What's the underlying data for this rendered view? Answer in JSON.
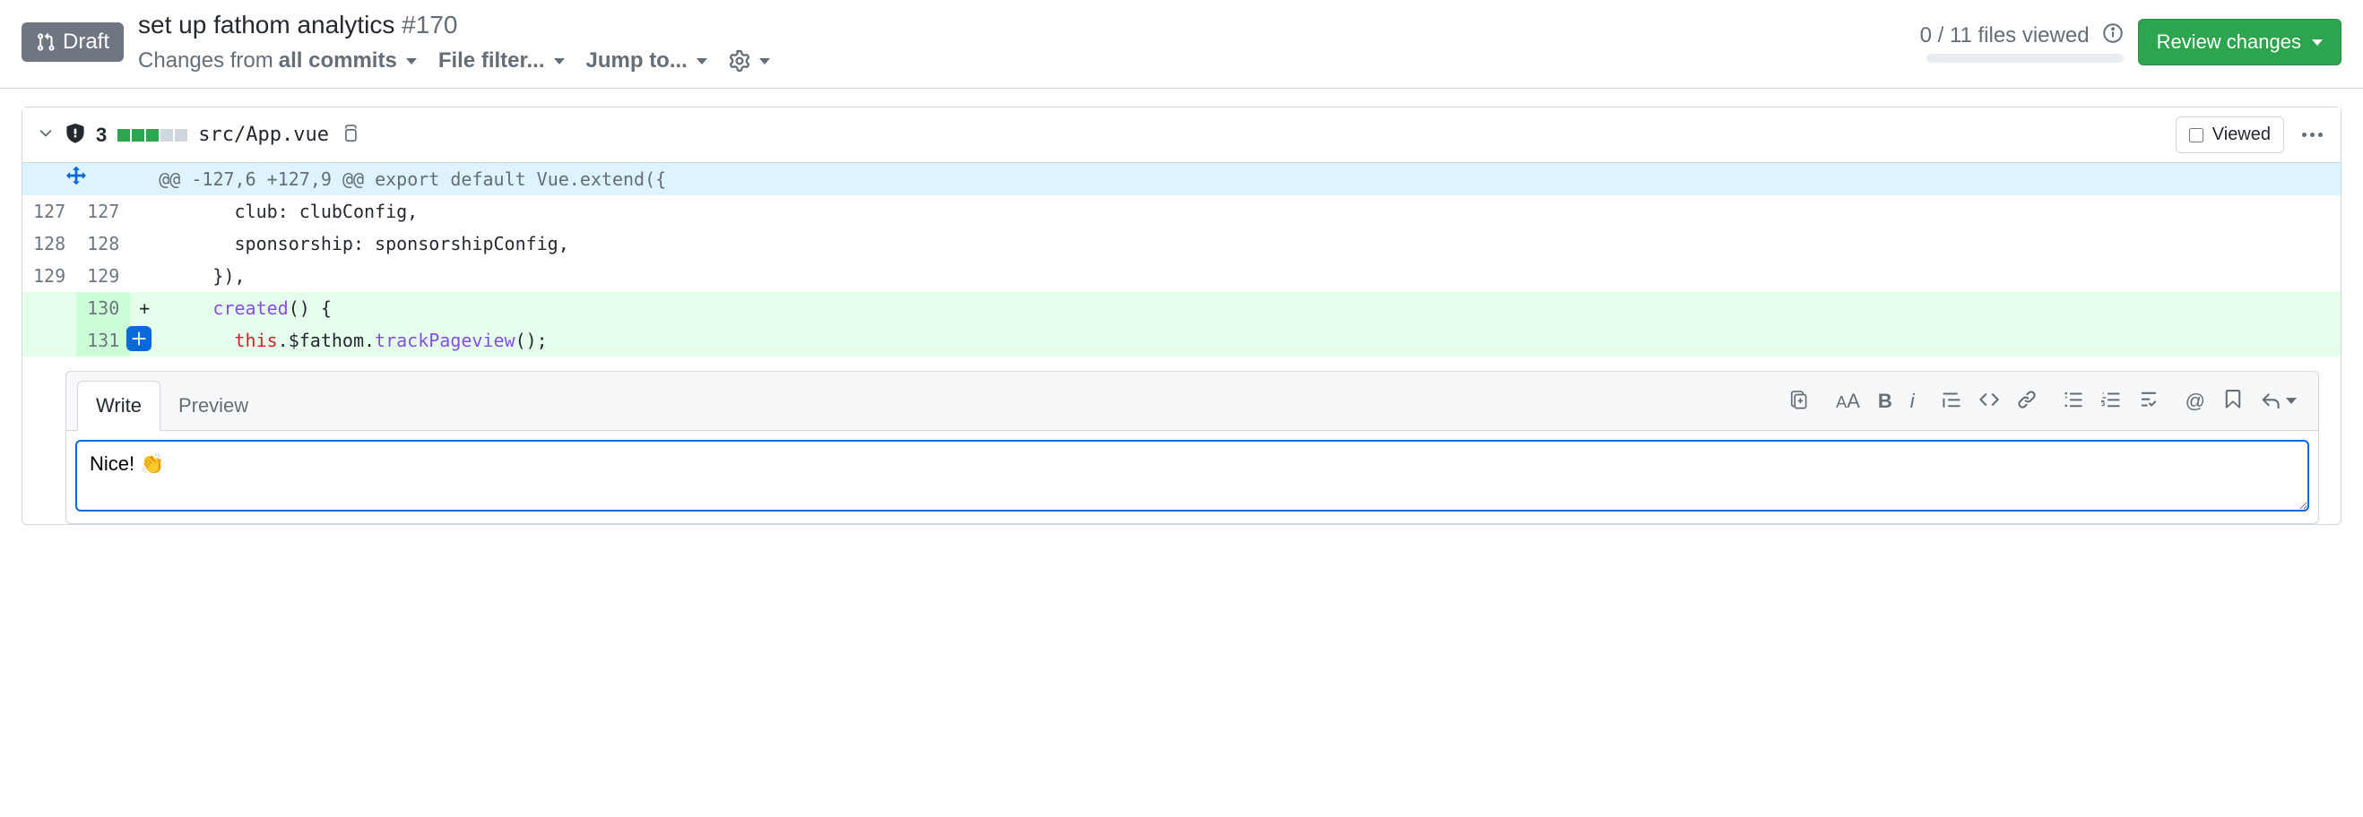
{
  "header": {
    "draft_label": "Draft",
    "title": "set up fathom analytics",
    "number": "#170",
    "changes_from_prefix": "Changes from",
    "changes_from_bold": "all commits",
    "file_filter": "File filter...",
    "jump_to": "Jump to...",
    "files_viewed": "0 / 11 files viewed",
    "review_changes": "Review changes"
  },
  "file": {
    "diff_count": "3",
    "path": "src/App.vue",
    "viewed_label": "Viewed"
  },
  "hunk": {
    "header": "@@ -127,6 +127,9 @@ export default Vue.extend({"
  },
  "lines": [
    {
      "old": "127",
      "new": "127",
      "marker": "",
      "code": "      club: clubConfig,"
    },
    {
      "old": "128",
      "new": "128",
      "marker": "",
      "code": "      sponsorship: sponsorshipConfig,"
    },
    {
      "old": "129",
      "new": "129",
      "marker": "",
      "code": "    }),"
    }
  ],
  "add_lines": [
    {
      "new": "130",
      "marker": "+",
      "code_pre": "    ",
      "code_func": "created",
      "code_post": "() {"
    },
    {
      "new": "131",
      "marker": "+",
      "code_pre": "      ",
      "code_kw": "this",
      "code_mid": ".$fathom.",
      "code_call": "trackPageview",
      "code_end": "();"
    }
  ],
  "comment": {
    "write_tab": "Write",
    "preview_tab": "Preview",
    "text": "Nice! 👏"
  }
}
